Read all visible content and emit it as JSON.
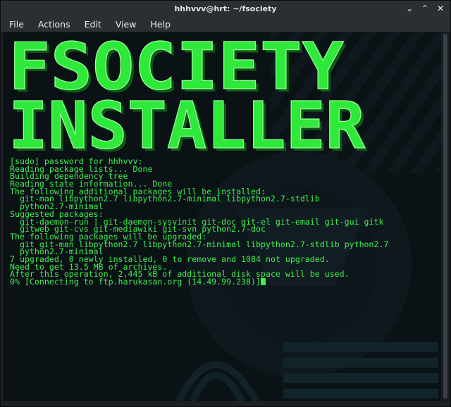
{
  "window": {
    "title": "hhhvvv@hrt: ~/fsociety",
    "buttons": {
      "minimize": "⌄",
      "maximize": "⌃",
      "close": "✕"
    }
  },
  "menu": [
    {
      "label": "File"
    },
    {
      "label": "Actions"
    },
    {
      "label": "Edit"
    },
    {
      "label": "View"
    },
    {
      "label": "Help"
    }
  ],
  "banner": {
    "line1": "FSOCIETY",
    "line2": "INSTALLER",
    "color": "#2ee83a"
  },
  "terminal": {
    "text_color": "#3ef04f",
    "lines": [
      "[sudo] password for hhhvvv:",
      "Reading package lists... Done",
      "Building dependency tree",
      "Reading state information... Done",
      "The following additional packages will be installed:",
      "  git-man libpython2.7 libpython2.7-minimal libpython2.7-stdlib",
      "  python2.7-minimal",
      "Suggested packages:",
      "  git-daemon-run | git-daemon-sysvinit git-doc git-el git-email git-gui gitk",
      "  gitweb git-cvs git-mediawiki git-svn python2.7-doc",
      "The following packages will be upgraded:",
      "  git git-man libpython2.7 libpython2.7-minimal libpython2.7-stdlib python2.7",
      "  python2.7-minimal",
      "7 upgraded, 0 newly installed, 0 to remove and 1084 not upgraded.",
      "Need to get 13.5 MB of archives.",
      "After this operation, 2,445 kB of additional disk space will be used.",
      "0% [Connecting to ftp.harukasan.org (14.49.99.238)]"
    ]
  }
}
